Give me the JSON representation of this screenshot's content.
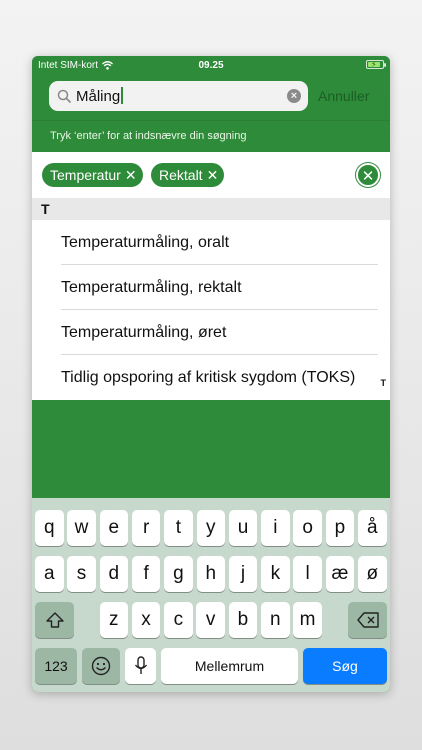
{
  "status": {
    "carrier": "Intet SIM-kort",
    "time": "09.25",
    "battery_level": 0.85
  },
  "search": {
    "query": "Måling",
    "cancel_label": "Annuller"
  },
  "hint": "Tryk ‘enter’ for at indsnævre din søgning",
  "chips": [
    {
      "label": "Temperatur"
    },
    {
      "label": "Rektalt"
    }
  ],
  "section_header": "T",
  "results": [
    "Temperaturmåling, oralt",
    "Temperaturmåling, rektalt",
    "Temperaturmåling, øret",
    "Tidlig opsporing af kritisk sygdom (TOKS)"
  ],
  "index_letter": "T",
  "keyboard": {
    "row1": [
      "q",
      "w",
      "e",
      "r",
      "t",
      "y",
      "u",
      "i",
      "o",
      "p",
      "å"
    ],
    "row2": [
      "a",
      "s",
      "d",
      "f",
      "g",
      "h",
      "j",
      "k",
      "l",
      "æ",
      "ø"
    ],
    "row3": [
      "z",
      "x",
      "c",
      "v",
      "b",
      "n",
      "m"
    ],
    "numbers_label": "123",
    "space_label": "Mellemrum",
    "search_label": "Søg"
  },
  "colors": {
    "accent": "#2e8b3a",
    "search_key": "#0a7cff"
  }
}
